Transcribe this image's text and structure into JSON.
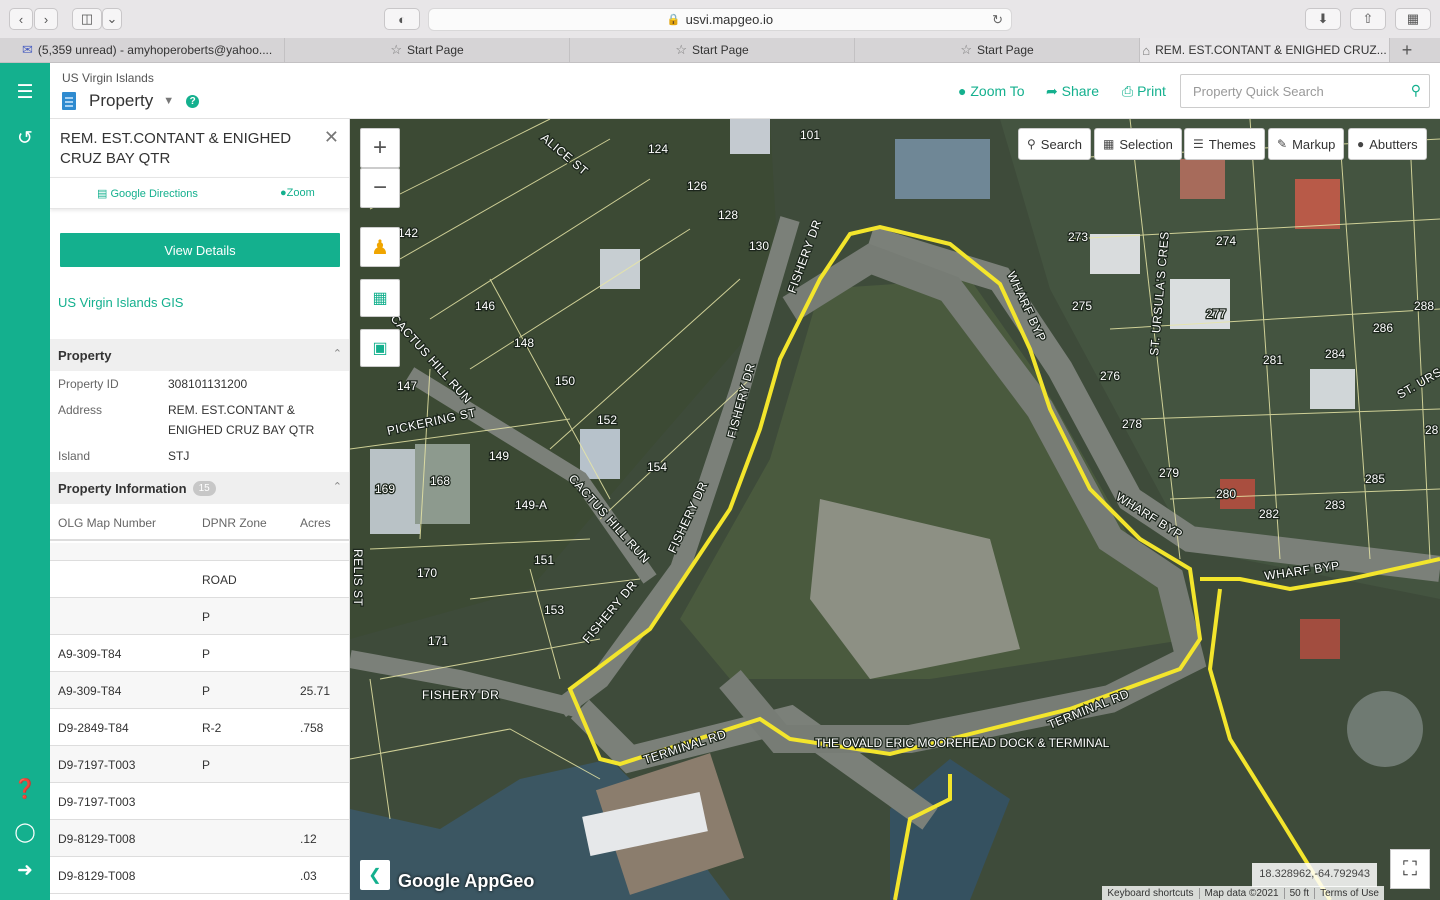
{
  "browser": {
    "url": "usvi.mapgeo.io",
    "tabs": [
      {
        "label": "(5,359 unread) - amyhoperoberts@yahoo....",
        "icon": "mail-icon"
      },
      {
        "label": "Start Page",
        "icon": "star-icon"
      },
      {
        "label": "Start Page",
        "icon": "star-icon"
      },
      {
        "label": "Start Page",
        "icon": "star-icon"
      },
      {
        "label": "REM. EST.CONTANT & ENIGHED CRUZ...",
        "icon": "home-icon"
      }
    ]
  },
  "header": {
    "region": "US Virgin Islands",
    "layer": "Property",
    "zoom_to": "Zoom To",
    "share": "Share",
    "print": "Print",
    "search_placeholder": "Property Quick Search"
  },
  "panel": {
    "title": "REM. EST.CONTANT & ENIGHED CRUZ BAY QTR",
    "google_directions": "Google Directions",
    "zoom": "Zoom",
    "view_details": "View Details",
    "gis_link": "US Virgin Islands GIS",
    "property_section": "Property",
    "fields": {
      "property_id_label": "Property ID",
      "property_id": "308101131200",
      "address_label": "Address",
      "address": "REM. EST.CONTANT & ENIGHED CRUZ BAY QTR",
      "island_label": "Island",
      "island": "STJ"
    },
    "info_section": "Property Information",
    "info_count": "15",
    "table": {
      "headers": [
        "OLG Map Number",
        "DPNR Zone",
        "Acres"
      ],
      "rows": [
        [
          "",
          "",
          ""
        ],
        [
          "",
          "ROAD",
          ""
        ],
        [
          "",
          "P",
          ""
        ],
        [
          "A9-309-T84",
          "P",
          ""
        ],
        [
          "A9-309-T84",
          "P",
          "25.71"
        ],
        [
          "D9-2849-T84",
          "R-2",
          ".758"
        ],
        [
          "D9-7197-T003",
          "P",
          ""
        ],
        [
          "D9-7197-T003",
          "",
          ""
        ],
        [
          "D9-8129-T008",
          "",
          ".12"
        ],
        [
          "D9-8129-T008",
          "",
          ".03"
        ]
      ]
    }
  },
  "map": {
    "tools": [
      "Search",
      "Selection",
      "Themes",
      "Markup",
      "Abutters"
    ],
    "coordinates": "18.328962,-64.792943",
    "attribution": [
      "Keyboard shortcuts",
      "Map data ©2021",
      "50 ft",
      "Terms of Use"
    ],
    "logo": "Google AppGeo",
    "parcel_labels": [
      "101",
      "124",
      "126",
      "128",
      "130",
      "142",
      "146",
      "147",
      "148",
      "149",
      "150",
      "152",
      "154",
      "149-A",
      "151",
      "153",
      "168",
      "169",
      "170",
      "171",
      "273",
      "274",
      "275",
      "276",
      "277",
      "278",
      "279",
      "280",
      "281",
      "282",
      "283",
      "284",
      "285",
      "286",
      "288",
      "28"
    ],
    "road_labels": [
      "ALICE ST",
      "FISHERY DR",
      "CACTUS HILL RUN",
      "PICKERING ST",
      "WHARF BYP",
      "ST. URSULA'S CRES",
      "TERMINAL RD",
      "RELIS ST",
      "ST. URS",
      "THE OVALD ERIC MOOREHEAD DOCK & TERMINAL"
    ]
  }
}
